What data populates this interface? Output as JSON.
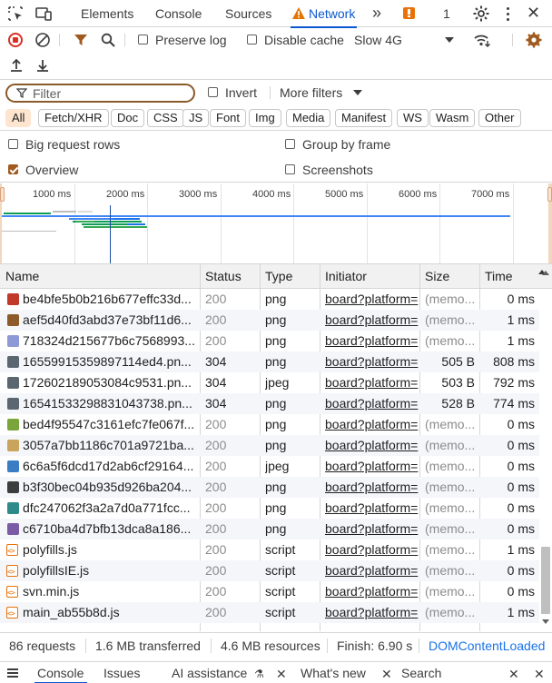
{
  "tabs": {
    "elements": "Elements",
    "console": "Console",
    "sources": "Sources",
    "network": "Network",
    "issue_count": "1"
  },
  "toolbar": {
    "preserve_log": "Preserve log",
    "disable_cache": "Disable cache",
    "throttle": "Slow 4G"
  },
  "filter": {
    "placeholder": "Filter",
    "invert": "Invert",
    "more_filters": "More filters"
  },
  "type_filters": [
    "All",
    "Fetch/XHR",
    "Doc",
    "CSS",
    "JS",
    "Font",
    "Img",
    "Media",
    "Manifest",
    "WS",
    "Wasm",
    "Other"
  ],
  "options": {
    "big_request_rows": "Big request rows",
    "group_by_frame": "Group by frame",
    "overview": "Overview",
    "screenshots": "Screenshots",
    "overview_checked": true
  },
  "overview_ticks": [
    "1000 ms",
    "2000 ms",
    "3000 ms",
    "4000 ms",
    "5000 ms",
    "6000 ms",
    "7000 ms"
  ],
  "columns": {
    "name": "Name",
    "status": "Status",
    "type": "Type",
    "initiator": "Initiator",
    "size": "Size",
    "time": "Time"
  },
  "rows": [
    {
      "name": "be4bfe5b0b216b677effc33d...",
      "status": "200",
      "type": "png",
      "initiator": "board?platform=",
      "size": "(memo...",
      "time": "0 ms",
      "icon": "image-red"
    },
    {
      "name": "aef5d40fd3abd37e73bf11d6...",
      "status": "200",
      "type": "png",
      "initiator": "board?platform=",
      "size": "(memo...",
      "time": "1 ms",
      "icon": "image-brown"
    },
    {
      "name": "718324d215677b6c7568993...",
      "status": "200",
      "type": "png",
      "initiator": "board?platform=",
      "size": "(memo...",
      "time": "1 ms",
      "icon": "image-lavender"
    },
    {
      "name": "16559915359897114ed4.pn...",
      "status": "304",
      "type": "png",
      "initiator": "board?platform=",
      "size": "505 B",
      "time": "808 ms",
      "icon": "image-gun"
    },
    {
      "name": "172602189053084c9531.pn...",
      "status": "304",
      "type": "jpeg",
      "initiator": "board?platform=",
      "size": "503 B",
      "time": "792 ms",
      "icon": "image-gun"
    },
    {
      "name": "16541533298831043738.pn...",
      "status": "304",
      "type": "png",
      "initiator": "board?platform=",
      "size": "528 B",
      "time": "774 ms",
      "icon": "image-gun"
    },
    {
      "name": "bed4f95547c3161efc7fe067f...",
      "status": "200",
      "type": "png",
      "initiator": "board?platform=",
      "size": "(memo...",
      "time": "0 ms",
      "icon": "image-green"
    },
    {
      "name": "3057a7bb1186c701a9721ba...",
      "status": "200",
      "type": "png",
      "initiator": "board?platform=",
      "size": "(memo...",
      "time": "0 ms",
      "icon": "image-tan"
    },
    {
      "name": "6c6a5f6dcd17d2ab6cf29164...",
      "status": "200",
      "type": "jpeg",
      "initiator": "board?platform=",
      "size": "(memo...",
      "time": "0 ms",
      "icon": "image-blue"
    },
    {
      "name": "b3f30bec04b935d926ba204...",
      "status": "200",
      "type": "png",
      "initiator": "board?platform=",
      "size": "(memo...",
      "time": "0 ms",
      "icon": "image-dark"
    },
    {
      "name": "dfc247062f3a2a7d0a771fcc...",
      "status": "200",
      "type": "png",
      "initiator": "board?platform=",
      "size": "(memo...",
      "time": "0 ms",
      "icon": "image-teal"
    },
    {
      "name": "c6710ba4d7bfb13dca8a186...",
      "status": "200",
      "type": "png",
      "initiator": "board?platform=",
      "size": "(memo...",
      "time": "0 ms",
      "icon": "image-purple"
    },
    {
      "name": "polyfills.js",
      "status": "200",
      "type": "script",
      "initiator": "board?platform=",
      "size": "(memo...",
      "time": "1 ms",
      "icon": "script"
    },
    {
      "name": "polyfillsIE.js",
      "status": "200",
      "type": "script",
      "initiator": "board?platform=",
      "size": "(memo...",
      "time": "0 ms",
      "icon": "script"
    },
    {
      "name": "svn.min.js",
      "status": "200",
      "type": "script",
      "initiator": "board?platform=",
      "size": "(memo...",
      "time": "0 ms",
      "icon": "script"
    },
    {
      "name": "main_ab55b8d.js",
      "status": "200",
      "type": "script",
      "initiator": "board?platform=",
      "size": "(memo...",
      "time": "1 ms",
      "icon": "script"
    }
  ],
  "status_bar": {
    "requests": "86 requests",
    "transferred": "1.6 MB transferred",
    "resources": "4.6 MB resources",
    "finish": "Finish: 6.90 s",
    "dcl": "DOMContentLoaded"
  },
  "drawer": {
    "console": "Console",
    "issues": "Issues",
    "ai": "AI assistance",
    "whats_new": "What's new",
    "search": "Search"
  },
  "colors": {
    "accent_blue": "#0b57d0",
    "warning_orange": "#e37400",
    "brand_brown": "#a05a1e",
    "dcl_blue": "#1a73e8"
  }
}
